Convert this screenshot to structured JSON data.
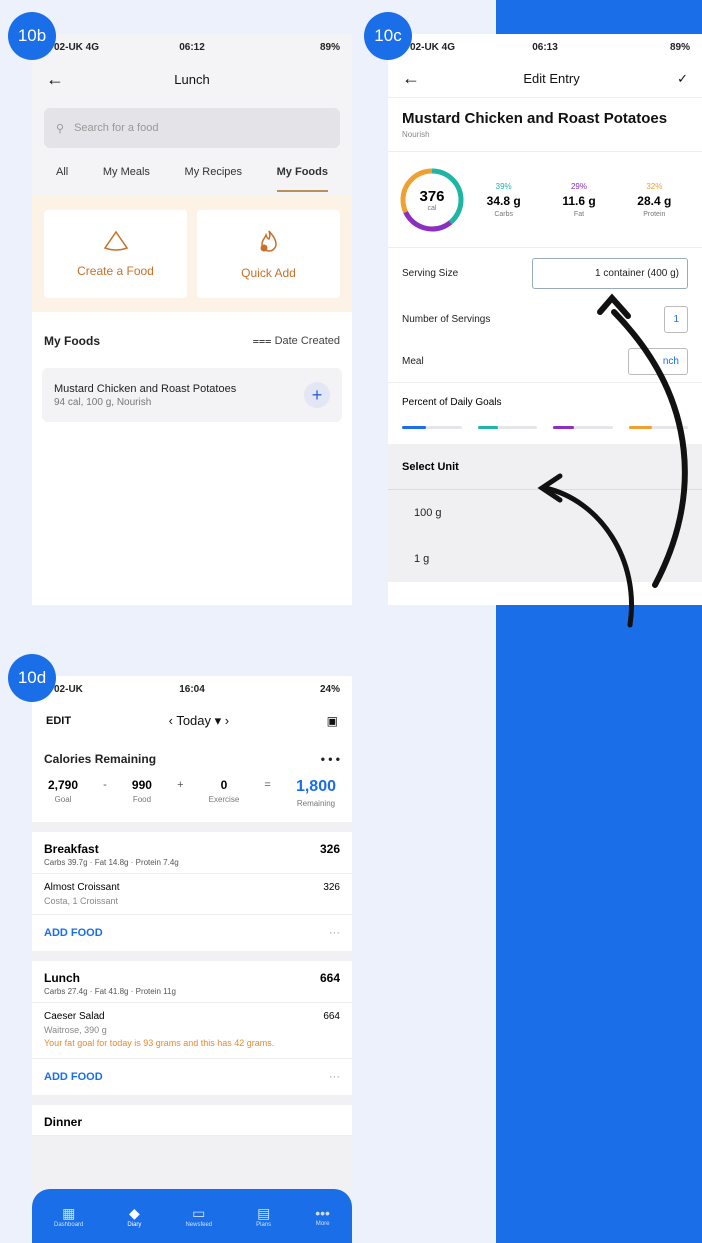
{
  "badges": {
    "a": "10b",
    "b": "10c",
    "c": "10d"
  },
  "s10b": {
    "status": {
      "carrier": "02-UK 4G",
      "time": "06:12",
      "battery": "89%"
    },
    "title": "Lunch",
    "search_placeholder": "Search for a food",
    "tabs": [
      "All",
      "My Meals",
      "My Recipes",
      "My Foods"
    ],
    "create_label": "Create a Food",
    "quick_label": "Quick Add",
    "section_title": "My Foods",
    "sort_label": "Date Created",
    "item_name": "Mustard Chicken and Roast Potatoes",
    "item_detail": "94 cal, 100 g, Nourish"
  },
  "s10c": {
    "status": {
      "carrier": "02-UK 4G",
      "time": "06:13",
      "battery": "89%"
    },
    "title": "Edit Entry",
    "food_title": "Mustard Chicken and Roast Potatoes",
    "brand": "Nourish",
    "calories": "376",
    "cal_unit": "cal",
    "macros": [
      {
        "pct": "39%",
        "val": "34.8 g",
        "label": "Carbs",
        "color": "#1fb5a5"
      },
      {
        "pct": "29%",
        "val": "11.6 g",
        "label": "Fat",
        "color": "#8a2fc0"
      },
      {
        "pct": "32%",
        "val": "28.4 g",
        "label": "Protein",
        "color": "#f0a030"
      }
    ],
    "serving_label": "Serving Size",
    "serving_value": "1 container (400 g)",
    "servings_label": "Number of Servings",
    "servings_value": "1",
    "meal_label": "Meal",
    "meal_value": "nch",
    "pdg_label": "Percent of Daily Goals",
    "unit_header": "Select Unit",
    "unit_options": [
      "100 g",
      "1 g"
    ]
  },
  "s10d": {
    "status": {
      "carrier": "02-UK",
      "time": "16:04",
      "battery": "24%"
    },
    "edit": "EDIT",
    "day": "Today",
    "cal_title": "Calories Remaining",
    "more": "• • •",
    "goal": "2,790",
    "goal_l": "Goal",
    "food": "990",
    "food_l": "Food",
    "exercise": "0",
    "exercise_l": "Exercise",
    "remaining": "1,800",
    "remaining_l": "Remaining",
    "breakfast": {
      "name": "Breakfast",
      "macros": "Carbs 39.7g · Fat 14.8g · Protein 7.4g",
      "cal": "326",
      "entry": "Almost Croissant",
      "entry_d": "Costa, 1 Croissant",
      "entry_c": "326"
    },
    "lunch": {
      "name": "Lunch",
      "macros": "Carbs 27.4g · Fat 41.8g · Protein 11g",
      "cal": "664",
      "entry": "Caeser Salad",
      "entry_d": "Waitrose, 390 g",
      "entry_c": "664",
      "warning": "Your fat goal for today is 93 grams and this has 42 grams."
    },
    "add_food": "ADD FOOD",
    "dots": "···",
    "dinner": "Dinner",
    "tabs": [
      "Dashboard",
      "Diary",
      "Newsfeed",
      "Plans",
      "More"
    ]
  },
  "colors": {
    "accent": "#1a6ee8",
    "orange": "#c7702a"
  }
}
